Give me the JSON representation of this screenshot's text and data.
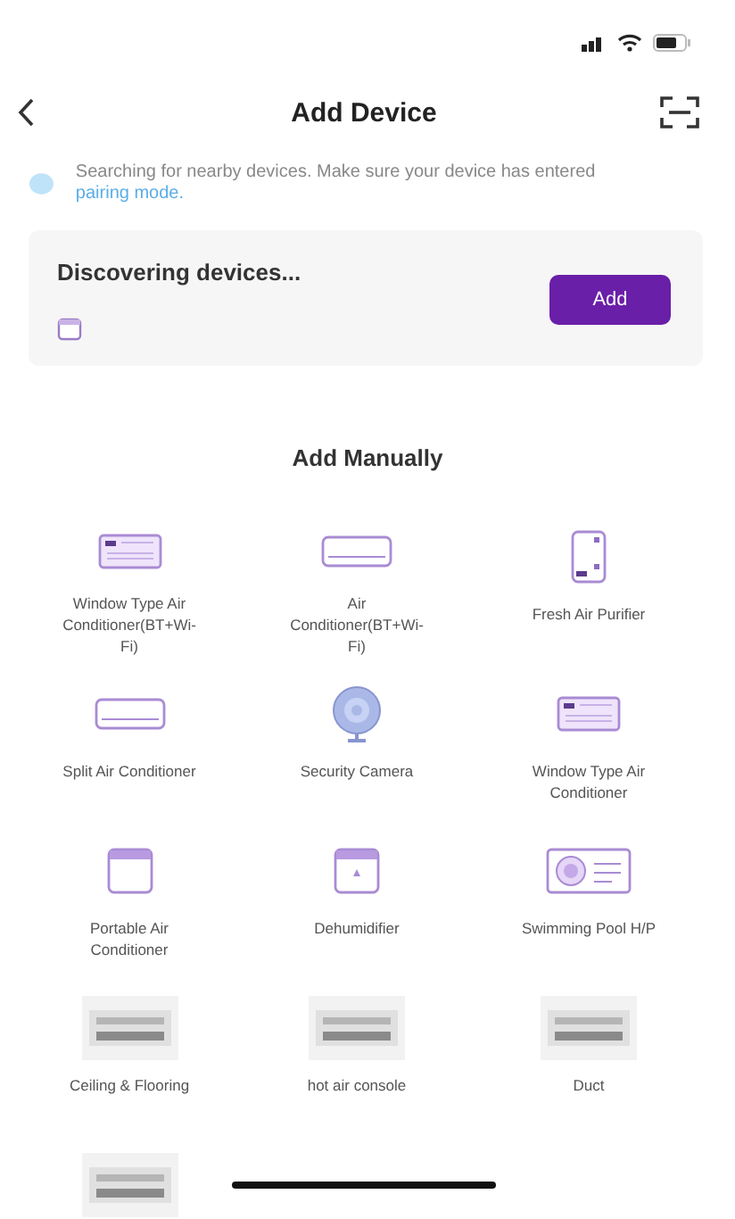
{
  "header": {
    "title": "Add Device"
  },
  "notice": {
    "text": "Searching for nearby devices. Make sure your device has entered ",
    "link": "pairing mode."
  },
  "discovery": {
    "title": "Discovering devices...",
    "button": "Add"
  },
  "section_title": "Add Manually",
  "devices": [
    {
      "kind": "window-ac",
      "label": "Window Type Air Conditioner(BT+Wi-Fi)"
    },
    {
      "kind": "split-ac",
      "label": "Air Conditioner(BT+Wi-Fi)"
    },
    {
      "kind": "purifier",
      "label": "Fresh Air Purifier"
    },
    {
      "kind": "split-ac",
      "label": "Split Air Conditioner"
    },
    {
      "kind": "camera",
      "label": "Security Camera"
    },
    {
      "kind": "window-ac",
      "label": "Window Type Air Conditioner"
    },
    {
      "kind": "portable",
      "label": "Portable Air Conditioner"
    },
    {
      "kind": "dehumidifier",
      "label": "Dehumidifier"
    },
    {
      "kind": "pool",
      "label": "Swimming Pool H/P"
    },
    {
      "kind": "picture",
      "label": "Ceiling & Flooring"
    },
    {
      "kind": "picture",
      "label": "hot air console"
    },
    {
      "kind": "picture",
      "label": "Duct"
    },
    {
      "kind": "picture"
    }
  ]
}
